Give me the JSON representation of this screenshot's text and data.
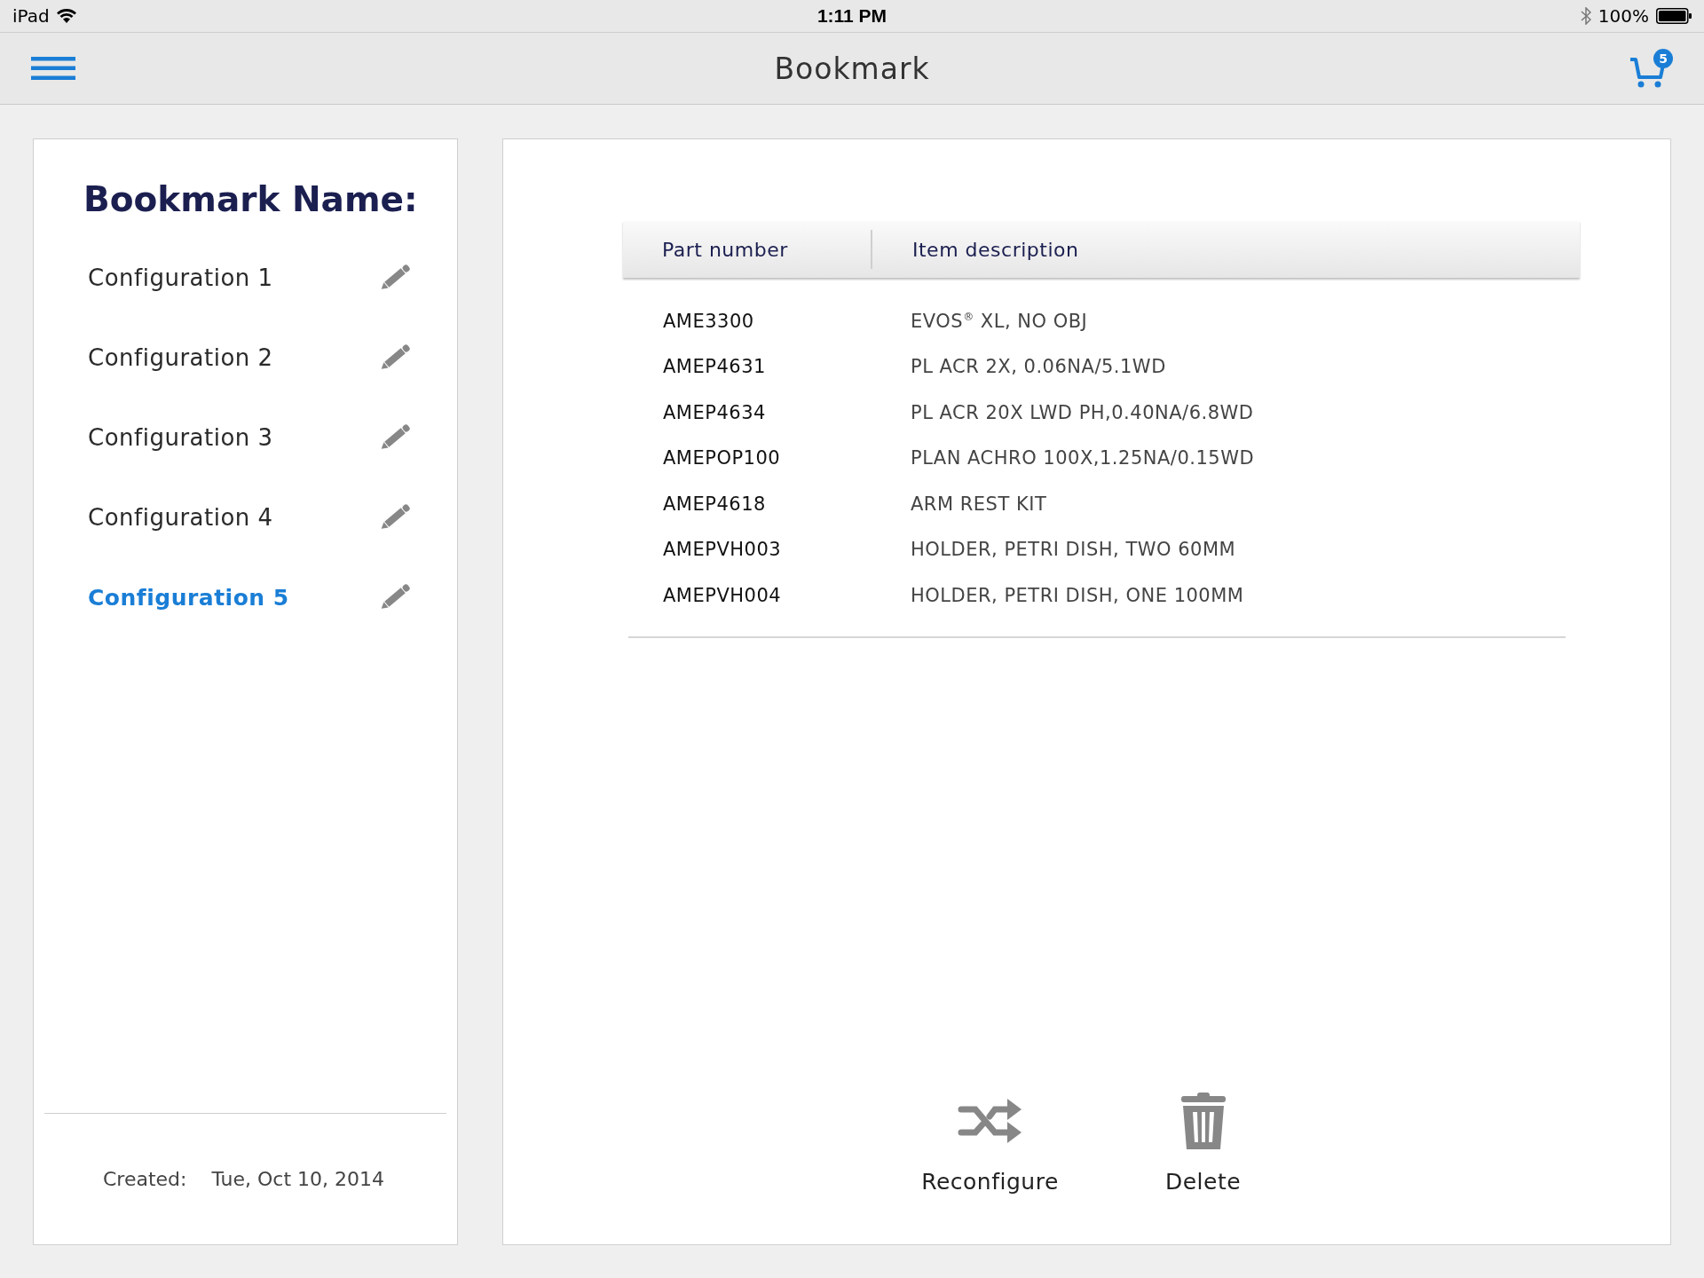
{
  "status_bar": {
    "device": "iPad",
    "time": "1:11 PM",
    "battery": "100%"
  },
  "nav": {
    "title": "Bookmark",
    "cart_count": "5"
  },
  "sidebar": {
    "heading": "Bookmark Name:",
    "items": [
      {
        "label": "Configuration 1",
        "selected": false
      },
      {
        "label": "Configuration 2",
        "selected": false
      },
      {
        "label": "Configuration 3",
        "selected": false
      },
      {
        "label": "Configuration 4",
        "selected": false
      },
      {
        "label": "Configuration 5",
        "selected": true
      }
    ],
    "created_label": "Created:",
    "created_date": "Tue, Oct 10, 2014"
  },
  "table": {
    "columns": [
      "Part number",
      "Item description"
    ],
    "rows": [
      {
        "part": "AME3300",
        "description": "EVOS$^{®}$ XL, NO OBJ"
      },
      {
        "part": "AMEP4631",
        "description": "PL ACR 2X, 0.06NA/5.1WD"
      },
      {
        "part": "AMEP4634",
        "description": "PL ACR 20X LWD PH,0.40NA/6.8WD"
      },
      {
        "part": "AMEPOP100",
        "description": "PLAN ACHRO 100X,1.25NA/0.15WD"
      },
      {
        "part": "AMEP4618",
        "description": "ARM REST KIT"
      },
      {
        "part": "AMEPVH003",
        "description": "HOLDER, PETRI DISH, TWO 60MM"
      },
      {
        "part": "AMEPVH004",
        "description": "HOLDER, PETRI DISH, ONE 100MM"
      }
    ]
  },
  "actions": [
    {
      "kind": "reconfigure",
      "label": "Reconfigure"
    },
    {
      "kind": "delete",
      "label": "Delete"
    }
  ]
}
